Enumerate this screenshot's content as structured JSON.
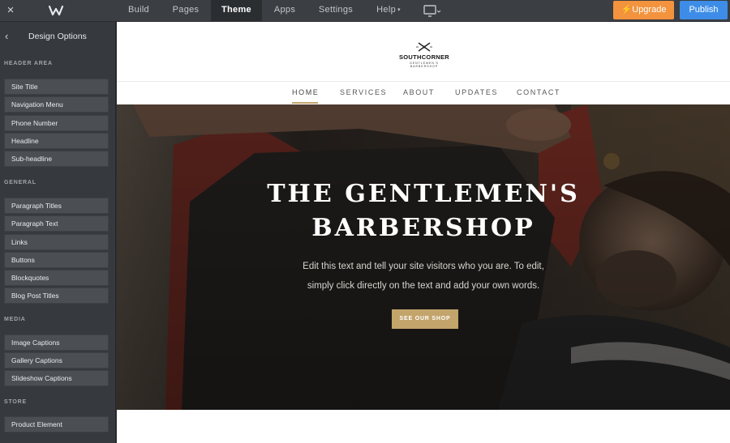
{
  "topbar": {
    "close_icon": "×",
    "logo": "weebly-logo",
    "nav": [
      {
        "label": "Build"
      },
      {
        "label": "Pages"
      },
      {
        "label": "Theme"
      },
      {
        "label": "Apps"
      },
      {
        "label": "Settings"
      },
      {
        "label": "Help"
      }
    ],
    "upgrade_label": "Upgrade",
    "publish_label": "Publish",
    "colors": {
      "upgrade": "#f3933d",
      "publish": "#3d8de8"
    }
  },
  "sidebar": {
    "title": "Design Options",
    "sections": [
      {
        "heading": "HEADER AREA",
        "items": [
          "Site Title",
          "Navigation Menu",
          "Phone Number",
          "Headline",
          "Sub-headline"
        ]
      },
      {
        "heading": "GENERAL",
        "items": [
          "Paragraph Titles",
          "Paragraph Text",
          "Links",
          "Buttons",
          "Blockquotes",
          "Blog Post Titles"
        ]
      },
      {
        "heading": "MEDIA",
        "items": [
          "Image Captions",
          "Gallery Captions",
          "Slideshow Captions"
        ]
      },
      {
        "heading": "STORE",
        "items": [
          "Product Element"
        ]
      }
    ]
  },
  "site": {
    "logo_name": "SOUTHCORNER",
    "logo_tagline": "GENTLEMEN'S BARBERSHOP",
    "nav": [
      "HOME",
      "SERVICES",
      "ABOUT",
      "UPDATES",
      "CONTACT"
    ],
    "hero": {
      "title_line1": "THE GENTLEMEN'S",
      "title_line2": "BARBERSHOP",
      "text_line1": "Edit this text and tell your site visitors who you are. To edit,",
      "text_line2": "simply click directly on the text and add your own words.",
      "button": "SEE OUR SHOP"
    },
    "accent_color": "#c3a46b"
  }
}
